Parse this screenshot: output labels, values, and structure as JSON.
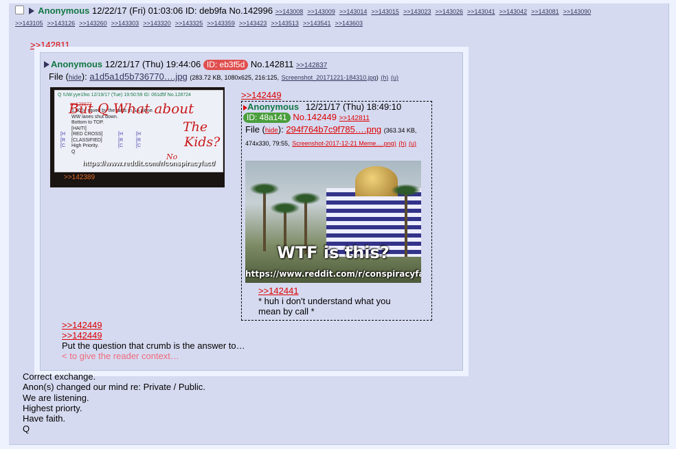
{
  "op": {
    "name": "Anonymous",
    "date": "12/22/17 (Fri) 01:03:06",
    "id_label": "ID: deb9fa",
    "no": "No.142996",
    "replies_line1": [
      ">>143008",
      ">>143009",
      ">>143014",
      ">>143015",
      ">>143023",
      ">>143026",
      ">>143041",
      ">>143042",
      ">>143081",
      ">>143090"
    ],
    "replies_line2": [
      ">>143105",
      ">>143126",
      ">>143260",
      ">>143303",
      ">>143320",
      ">>143325",
      ">>143359",
      ">>143423",
      ">>143513",
      ">>143541",
      ">>143603"
    ],
    "ref_top": ">>142811",
    "body": [
      "Correct exchange.",
      "Anon(s) changed our mind re: Private / Public.",
      "We are listening.",
      "Highest priorty.",
      "Have faith.",
      "Q"
    ]
  },
  "quoted": {
    "name": "Anonymous",
    "date": "12/21/17 (Thu) 19:44:06",
    "id": "ID: eb3f5d",
    "no": "No.142811",
    "backlink": ">>142837",
    "file_label": "File (",
    "hide": "hide",
    "file_label_close": "):",
    "filename": "a1d5a1d5b736770….jpg",
    "file_meta": "(283.72 KB, 1080x625, 216:125,",
    "orig_name": "Screenshot_20171221-184310.jpg",
    "h": "(h)",
    "u": "(u)",
    "thumb": {
      "header": "Q !UW.yye1fxo 12/19/17 (Tue) 19:50:59 ID: 061d5f No.128724",
      "lines": [
        "1,000+ saved by the raids in SA alone.",
        "WW lanes shut down.",
        "Bottom to TOP.",
        "[HAITI]",
        "[RED CROSS]",
        "[CLASSIFIED]",
        "High Priority.",
        "Q"
      ],
      "col2": [
        "[H",
        "[R",
        "[C"
      ],
      "col3": [
        "[H",
        "[R",
        "[C"
      ],
      "col1": [
        "[H",
        "[R",
        "[C"
      ],
      "hand1": "But Q What about",
      "hand2": "The",
      "hand3": "Kids?",
      "hand4": "No",
      "url": "https://www.reddit.com/r/conspiracyfact/",
      "ref": ">>142389",
      "strike": ">>128977"
    },
    "reply_ref1": ">>142449",
    "reply_ref2": ">>142449",
    "reply_text": "Put the question that crumb is the answer to…",
    "greentext": "< to give the reader context…"
  },
  "nested": {
    "ref": ">>142449",
    "name": "Anonymous",
    "date": "12/21/17 (Thu) 18:49:10",
    "id": "ID: 48a141",
    "no": "No.142449",
    "backlink": ">>142811",
    "file_label": "File (",
    "hide": "hide",
    "file_label_close": "):",
    "filename": "294f764b7c9f785….png",
    "file_meta1": "(363.34 KB,",
    "file_meta2": "474x330, 79:55,",
    "orig_name": "Screenshot-2017-12-21 Meme….png)",
    "h": "(h)",
    "u": "(u)",
    "meme_text": "WTF is this?",
    "meme_url": "https://www.reddit.com/r/conspiracyfact/",
    "reply_ref": ">>142441",
    "reply_text1": "* huh i don't understand what you",
    "reply_text2": "mean by call *"
  }
}
